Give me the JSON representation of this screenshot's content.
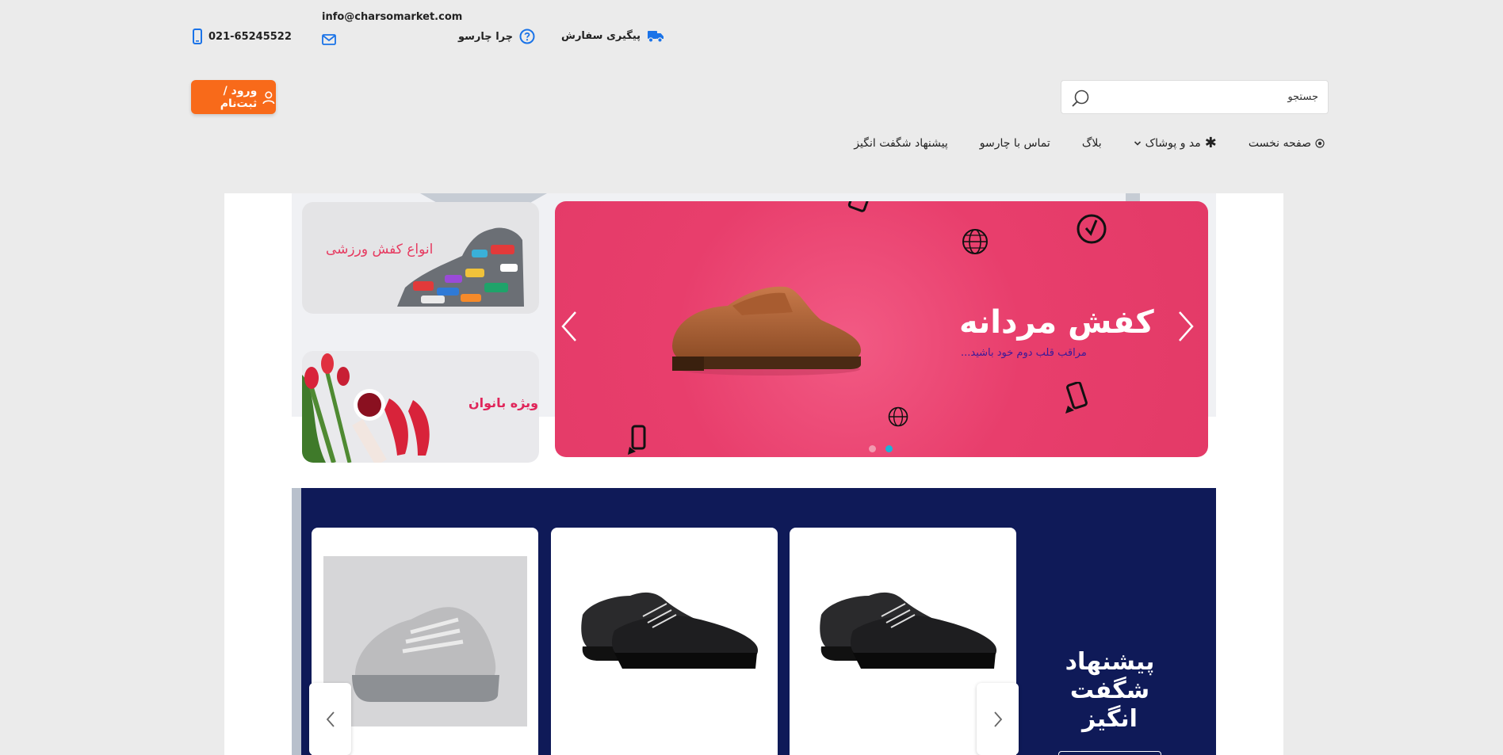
{
  "topbar": {
    "phone": "021-65245522",
    "email": "info@charsomarket.com",
    "why": "چرا چارسو",
    "track": "پیگیری سفارش"
  },
  "search": {
    "placeholder": "جستجو"
  },
  "login": {
    "label": "ورود / ثبت‌نام"
  },
  "nav": {
    "home": "صفحه نخست",
    "fashion": "مد و پوشاک",
    "blog": "بلاگ",
    "contact": "تماس با چارسو",
    "offer": "پیشنهاد شگفت انگیز"
  },
  "slider": {
    "title": "کفش مردانه",
    "subtitle": "مراقب قلب دوم خود باشید..."
  },
  "banners": {
    "sport": "انواع کفش ورزشی",
    "women": "ویژه بانوان"
  },
  "deals": {
    "title": "پیشنهاد شگفت انگیز"
  },
  "colors": {
    "accent": "#f86a1a",
    "icon_blue": "#1a73e8",
    "slider_pink": "#e83e6c",
    "deals_navy": "#0f1a58"
  }
}
